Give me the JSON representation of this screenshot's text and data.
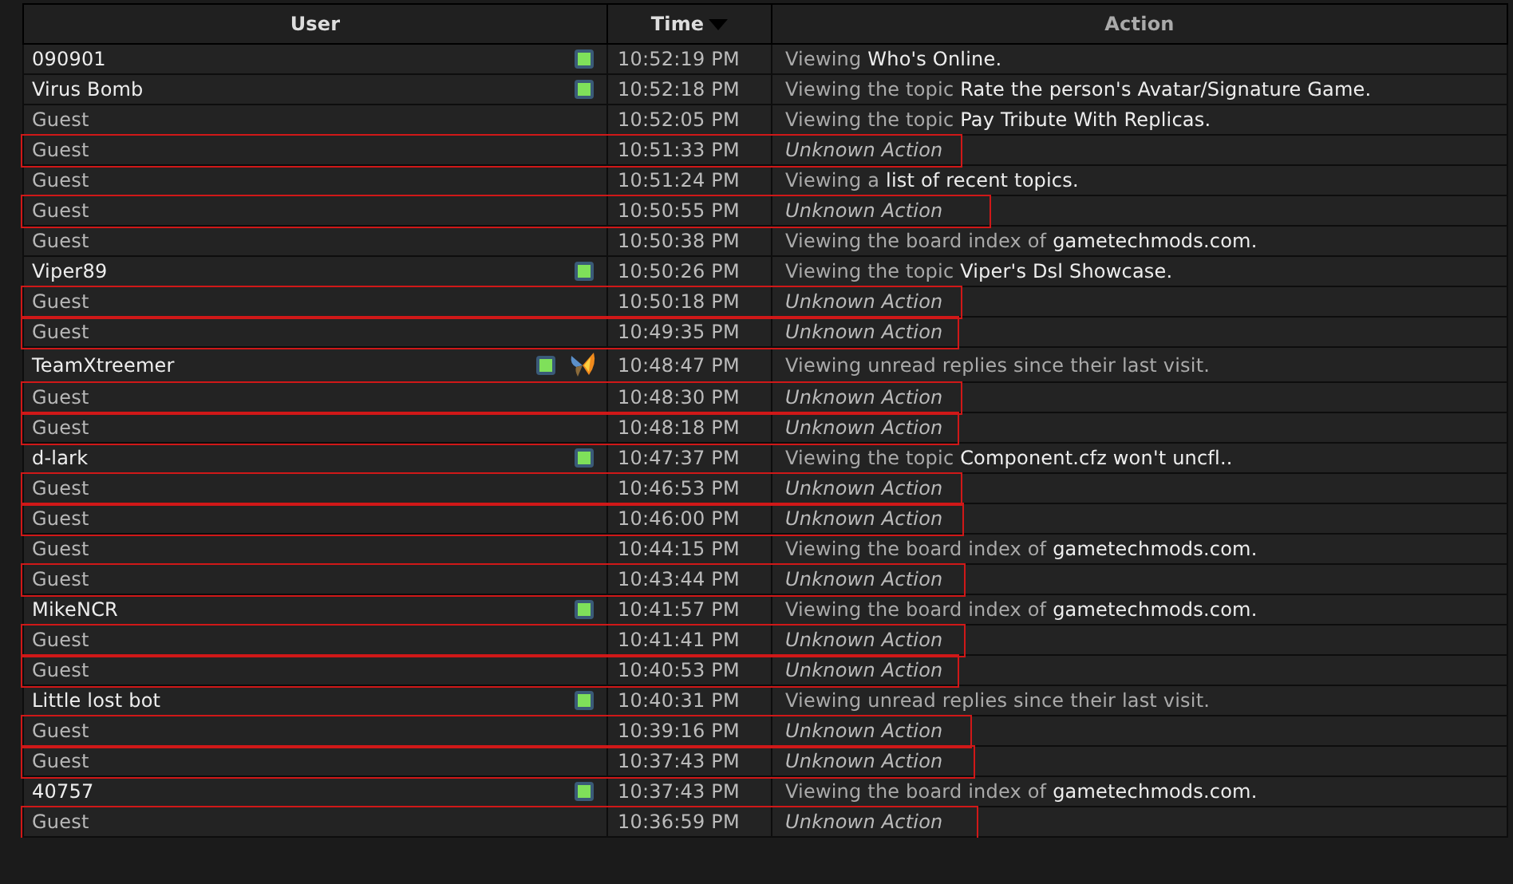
{
  "table": {
    "columns": [
      {
        "label": "User",
        "sorted": false
      },
      {
        "label": "Time",
        "sorted": true
      },
      {
        "label": "Action",
        "sorted": false
      }
    ],
    "rows": [
      {
        "user": "090901",
        "kind": "member",
        "online": true,
        "time": "10:52:19 PM",
        "action": {
          "kind": "viewing",
          "text": "Viewing",
          "target": "Who's Online."
        },
        "highlighted": false
      },
      {
        "user": "Virus Bomb",
        "kind": "member",
        "online": true,
        "time": "10:52:18 PM",
        "action": {
          "kind": "viewing",
          "text": "Viewing the topic",
          "target": "Rate the person's Avatar/Signature Game."
        },
        "highlighted": false
      },
      {
        "user": "Guest",
        "kind": "guest",
        "online": false,
        "time": "10:52:05 PM",
        "action": {
          "kind": "viewing",
          "text": "Viewing the topic",
          "target": "Pay Tribute With Replicas."
        },
        "highlighted": false
      },
      {
        "user": "Guest",
        "kind": "guest",
        "online": false,
        "time": "10:51:33 PM",
        "action": {
          "kind": "unknown",
          "text": "Unknown Action"
        },
        "highlighted": true
      },
      {
        "user": "Guest",
        "kind": "guest",
        "online": false,
        "time": "10:51:24 PM",
        "action": {
          "kind": "viewing",
          "text": "Viewing a",
          "target": "list of recent topics."
        },
        "highlighted": false
      },
      {
        "user": "Guest",
        "kind": "guest",
        "online": false,
        "time": "10:50:55 PM",
        "action": {
          "kind": "unknown",
          "text": "Unknown Action"
        },
        "highlighted": true
      },
      {
        "user": "Guest",
        "kind": "guest",
        "online": false,
        "time": "10:50:38 PM",
        "action": {
          "kind": "viewing",
          "text": "Viewing the board index of",
          "target": "gametechmods.com."
        },
        "highlighted": false
      },
      {
        "user": "Viper89",
        "kind": "member",
        "online": true,
        "time": "10:50:26 PM",
        "action": {
          "kind": "viewing",
          "text": "Viewing the topic",
          "target": "Viper's Dsl Showcase."
        },
        "highlighted": false
      },
      {
        "user": "Guest",
        "kind": "guest",
        "online": false,
        "time": "10:50:18 PM",
        "action": {
          "kind": "unknown",
          "text": "Unknown Action"
        },
        "highlighted": true
      },
      {
        "user": "Guest",
        "kind": "guest",
        "online": false,
        "time": "10:49:35 PM",
        "action": {
          "kind": "unknown",
          "text": "Unknown Action"
        },
        "highlighted": true
      },
      {
        "user": "TeamXtreemer",
        "kind": "member",
        "online": true,
        "rank_icon": true,
        "time": "10:48:47 PM",
        "action": {
          "kind": "viewing",
          "text": "Viewing unread replies since their last visit."
        },
        "highlighted": false
      },
      {
        "user": "Guest",
        "kind": "guest",
        "online": false,
        "time": "10:48:30 PM",
        "action": {
          "kind": "unknown",
          "text": "Unknown Action"
        },
        "highlighted": true
      },
      {
        "user": "Guest",
        "kind": "guest",
        "online": false,
        "time": "10:48:18 PM",
        "action": {
          "kind": "unknown",
          "text": "Unknown Action"
        },
        "highlighted": true
      },
      {
        "user": "d-lark",
        "kind": "member",
        "online": true,
        "time": "10:47:37 PM",
        "action": {
          "kind": "viewing",
          "text": "Viewing the topic",
          "target": "Component.cfz won't uncfl.."
        },
        "highlighted": false
      },
      {
        "user": "Guest",
        "kind": "guest",
        "online": false,
        "time": "10:46:53 PM",
        "action": {
          "kind": "unknown",
          "text": "Unknown Action"
        },
        "highlighted": true
      },
      {
        "user": "Guest",
        "kind": "guest",
        "online": false,
        "time": "10:46:00 PM",
        "action": {
          "kind": "unknown",
          "text": "Unknown Action"
        },
        "highlighted": true
      },
      {
        "user": "Guest",
        "kind": "guest",
        "online": false,
        "time": "10:44:15 PM",
        "action": {
          "kind": "viewing",
          "text": "Viewing the board index of",
          "target": "gametechmods.com."
        },
        "highlighted": false
      },
      {
        "user": "Guest",
        "kind": "guest",
        "online": false,
        "time": "10:43:44 PM",
        "action": {
          "kind": "unknown",
          "text": "Unknown Action"
        },
        "highlighted": true
      },
      {
        "user": "MikeNCR",
        "kind": "member",
        "online": true,
        "time": "10:41:57 PM",
        "action": {
          "kind": "viewing",
          "text": "Viewing the board index of",
          "target": "gametechmods.com."
        },
        "highlighted": false
      },
      {
        "user": "Guest",
        "kind": "guest",
        "online": false,
        "time": "10:41:41 PM",
        "action": {
          "kind": "unknown",
          "text": "Unknown Action"
        },
        "highlighted": true
      },
      {
        "user": "Guest",
        "kind": "guest",
        "online": false,
        "time": "10:40:53 PM",
        "action": {
          "kind": "unknown",
          "text": "Unknown Action"
        },
        "highlighted": true
      },
      {
        "user": "Little lost bot",
        "kind": "member",
        "online": true,
        "time": "10:40:31 PM",
        "action": {
          "kind": "viewing",
          "text": "Viewing unread replies since their last visit."
        },
        "highlighted": false
      },
      {
        "user": "Guest",
        "kind": "guest",
        "online": false,
        "time": "10:39:16 PM",
        "action": {
          "kind": "unknown",
          "text": "Unknown Action"
        },
        "highlighted": true
      },
      {
        "user": "Guest",
        "kind": "guest",
        "online": false,
        "time": "10:37:43 PM",
        "action": {
          "kind": "unknown",
          "text": "Unknown Action"
        },
        "highlighted": true
      },
      {
        "user": "40757",
        "kind": "member",
        "online": true,
        "time": "10:37:43 PM",
        "action": {
          "kind": "viewing",
          "text": "Viewing the board index of",
          "target": "gametechmods.com."
        },
        "highlighted": false
      },
      {
        "user": "Guest",
        "kind": "guest",
        "online": false,
        "time": "10:36:59 PM",
        "action": {
          "kind": "unknown",
          "text": "Unknown Action"
        },
        "highlighted": true
      }
    ]
  }
}
